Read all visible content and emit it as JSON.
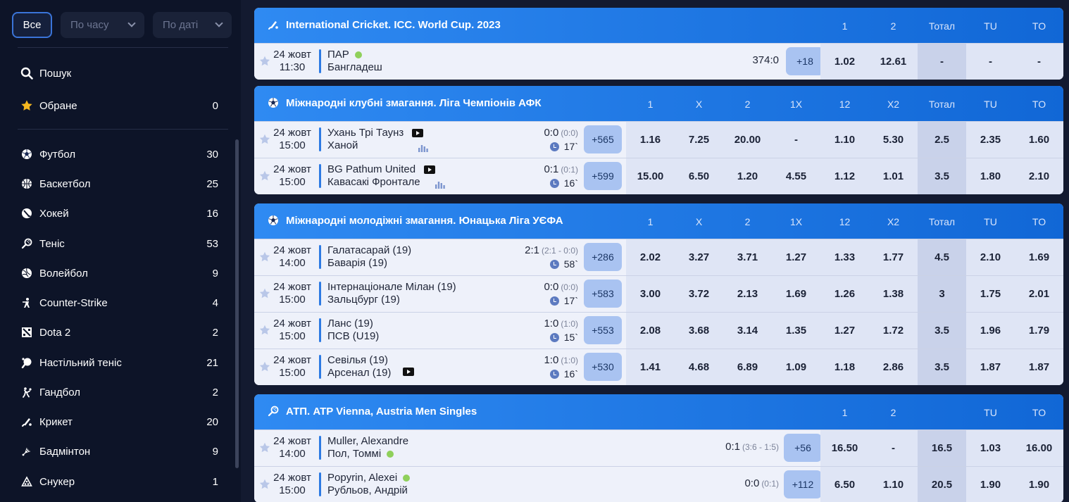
{
  "filters": {
    "all": "Все",
    "by_time": "По часу",
    "by_date": "По даті"
  },
  "search": "Пошук",
  "favorites": {
    "label": "Обране",
    "count": "0"
  },
  "sports": [
    {
      "icon": "football-icon",
      "label": "Футбол",
      "count": "30"
    },
    {
      "icon": "basketball-icon",
      "label": "Баскетбол",
      "count": "25"
    },
    {
      "icon": "hockey-icon",
      "label": "Хокей",
      "count": "16"
    },
    {
      "icon": "tennis-icon",
      "label": "Теніс",
      "count": "53"
    },
    {
      "icon": "volleyball-icon",
      "label": "Волейбол",
      "count": "9"
    },
    {
      "icon": "counter-strike-icon",
      "label": "Counter-Strike",
      "count": "4"
    },
    {
      "icon": "dota2-icon",
      "label": "Dota 2",
      "count": "2"
    },
    {
      "icon": "table-tennis-icon",
      "label": "Настільний теніс",
      "count": "21"
    },
    {
      "icon": "handball-icon",
      "label": "Гандбол",
      "count": "2"
    },
    {
      "icon": "cricket-icon",
      "label": "Крикет",
      "count": "20"
    },
    {
      "icon": "badminton-icon",
      "label": "Бадмінтон",
      "count": "9"
    },
    {
      "icon": "snooker-icon",
      "label": "Снукер",
      "count": "1"
    }
  ],
  "blocks": [
    {
      "title": "International Cricket. ICC. World Cup. 2023",
      "icon": "cricket-icon",
      "cols": [
        "1",
        "2",
        "Тотал",
        "TU",
        "TO"
      ],
      "rows": [
        {
          "date": "24 жовт",
          "time": "11:30",
          "team1": "ПАР",
          "team2": "Бангладеш",
          "score": "374:0",
          "sub": "",
          "minute": "",
          "more": "+18",
          "odds": [
            "1.02",
            "12.61",
            "-",
            "-",
            "-"
          ]
        }
      ]
    },
    {
      "title": "Міжнародні клубні змагання. Ліга Чемпіонів АФК",
      "icon": "football-icon",
      "cols": [
        "1",
        "X",
        "2",
        "1X",
        "12",
        "X2",
        "Тотал",
        "TU",
        "TO"
      ],
      "rows": [
        {
          "date": "24 жовт",
          "time": "15:00",
          "team1": "Ухань Трі Таунз",
          "team2": "Ханой",
          "score": "0:0",
          "sub": "(0:0)",
          "minute": "17`",
          "more": "+565",
          "odds": [
            "1.16",
            "7.25",
            "20.00",
            "-",
            "1.10",
            "5.30",
            "2.5",
            "2.35",
            "1.60"
          ]
        },
        {
          "date": "24 жовт",
          "time": "15:00",
          "team1": "BG Pathum United",
          "team2": "Кавасакі Фронтале",
          "score": "0:1",
          "sub": "(0:1)",
          "minute": "16`",
          "more": "+599",
          "odds": [
            "15.00",
            "6.50",
            "1.20",
            "4.55",
            "1.12",
            "1.01",
            "3.5",
            "1.80",
            "2.10"
          ]
        }
      ]
    },
    {
      "title": "Міжнародні молодіжні змагання. Юнацька Ліга УЄФА",
      "icon": "football-icon",
      "cols": [
        "1",
        "X",
        "2",
        "1X",
        "12",
        "X2",
        "Тотал",
        "TU",
        "TO"
      ],
      "rows": [
        {
          "date": "24 жовт",
          "time": "14:00",
          "team1": "Галатасарай (19)",
          "team2": "Баварія (19)",
          "score": "2:1",
          "sub": "(2:1 - 0:0)",
          "minute": "58`",
          "more": "+286",
          "odds": [
            "2.02",
            "3.27",
            "3.71",
            "1.27",
            "1.33",
            "1.77",
            "4.5",
            "2.10",
            "1.69"
          ]
        },
        {
          "date": "24 жовт",
          "time": "15:00",
          "team1": "Інтернаціонале Мілан (19)",
          "team2": "Зальцбург (19)",
          "score": "0:0",
          "sub": "(0:0)",
          "minute": "17`",
          "more": "+583",
          "odds": [
            "3.00",
            "3.72",
            "2.13",
            "1.69",
            "1.26",
            "1.38",
            "3",
            "1.75",
            "2.01"
          ]
        },
        {
          "date": "24 жовт",
          "time": "15:00",
          "team1": "Ланс (19)",
          "team2": "ПСВ (U19)",
          "score": "1:0",
          "sub": "(1:0)",
          "minute": "15`",
          "more": "+553",
          "odds": [
            "2.08",
            "3.68",
            "3.14",
            "1.35",
            "1.27",
            "1.72",
            "3.5",
            "1.96",
            "1.79"
          ]
        },
        {
          "date": "24 жовт",
          "time": "15:00",
          "team1": "Севілья (19)",
          "team2": "Арсенал (19)",
          "score": "1:0",
          "sub": "(1:0)",
          "minute": "16`",
          "more": "+530",
          "odds": [
            "1.41",
            "4.68",
            "6.89",
            "1.09",
            "1.18",
            "2.86",
            "3.5",
            "1.87",
            "1.87"
          ]
        }
      ]
    },
    {
      "title": "АТП. ATP Vienna, Austria Men Singles",
      "icon": "tennis-icon",
      "cols": [
        "1",
        "2",
        "",
        "TU",
        "TO"
      ],
      "rows": [
        {
          "date": "24 жовт",
          "time": "14:00",
          "team1": "Muller, Alexandre",
          "team2": "Пол, Томмі",
          "score": "0:1",
          "sub": "(3:6 - 1:5)",
          "minute": "",
          "more": "+56",
          "odds": [
            "16.50",
            "-",
            "16.5",
            "1.03",
            "16.00"
          ]
        },
        {
          "date": "24 жовт",
          "time": "15:00",
          "team1": "Popyrin, Alexei",
          "team2": "Рубльов, Андрій",
          "score": "0:0",
          "sub": "(0:1)",
          "minute": "",
          "more": "+112",
          "odds": [
            "6.50",
            "1.10",
            "20.5",
            "1.90",
            "1.90"
          ]
        }
      ]
    }
  ]
}
